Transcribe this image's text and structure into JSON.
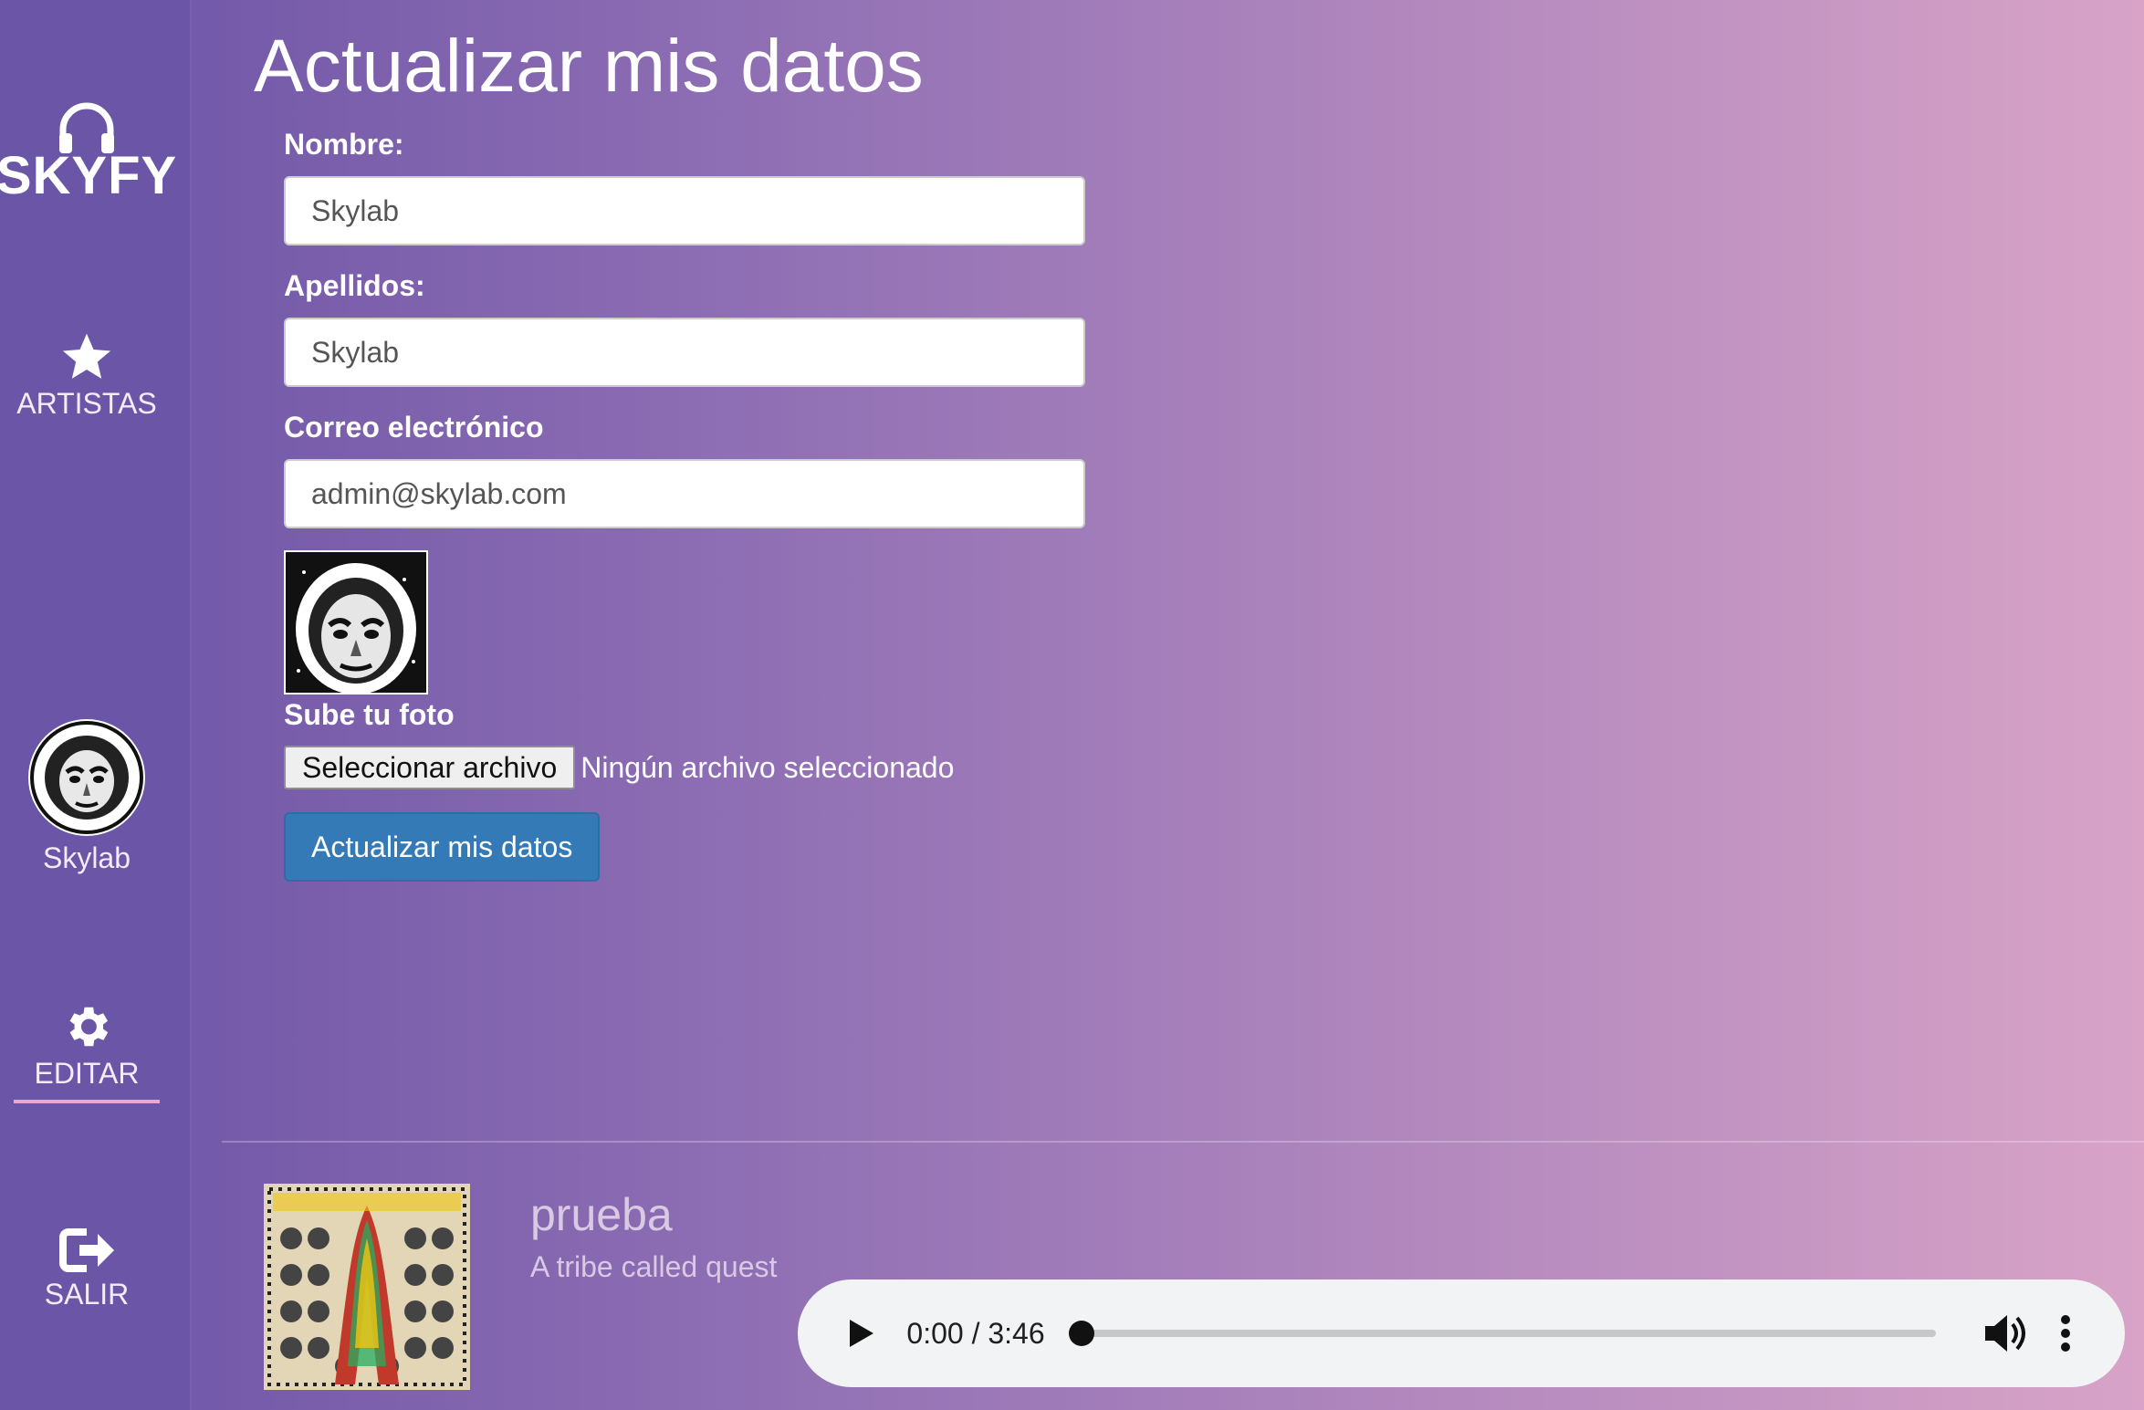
{
  "sidebar": {
    "logo_text": "SKYFY",
    "artists_label": "ARTISTAS",
    "profile_name": "Skylab",
    "edit_label": "EDITAR",
    "logout_label": "SALIR"
  },
  "icons": {
    "logo": "headphones-icon",
    "artists": "star-icon",
    "edit": "gear-icon",
    "logout": "sign-out-icon"
  },
  "form": {
    "title": "Actualizar mis datos",
    "name_label": "Nombre:",
    "name_value": "Skylab",
    "surname_label": "Apellidos:",
    "surname_value": "Skylab",
    "email_label": "Correo electrónico",
    "email_value": "admin@skylab.com",
    "photo_label": "Sube tu foto",
    "file_button": "Seleccionar archivo",
    "file_status": "Ningún archivo seleccionado",
    "submit_label": "Actualizar mis datos"
  },
  "player": {
    "track_title": "prueba",
    "track_artist": "A tribe called quest",
    "current_time": "0:00",
    "duration": "3:46",
    "time_display": "0:00 / 3:46",
    "progress": 0.0
  },
  "colors": {
    "sidebar": "#6b55a7",
    "submit": "#337ab7",
    "edit_underline": "#e6a9d6"
  }
}
